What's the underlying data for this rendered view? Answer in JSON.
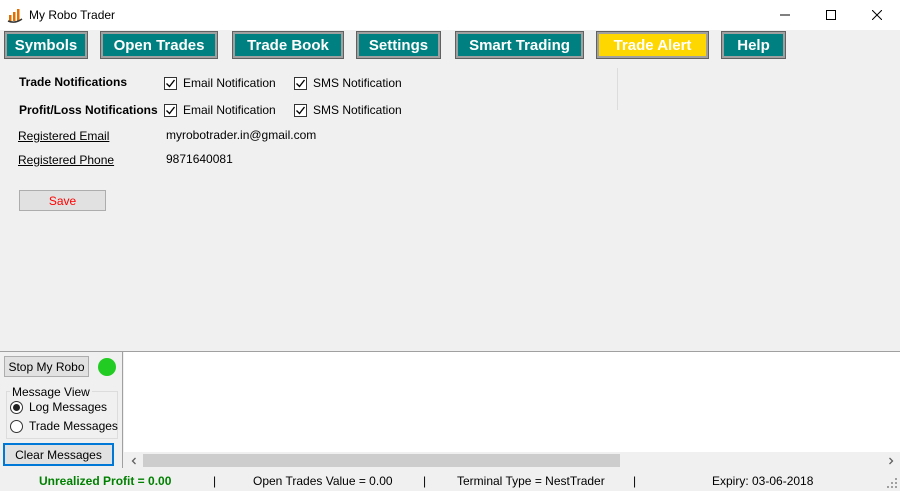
{
  "window": {
    "title": "My Robo Trader"
  },
  "nav": [
    {
      "label": "Symbols",
      "active": false
    },
    {
      "label": "Open Trades",
      "active": false
    },
    {
      "label": "Trade Book",
      "active": false
    },
    {
      "label": "Settings",
      "active": false
    },
    {
      "label": "Smart Trading",
      "active": false
    },
    {
      "label": "Trade Alert",
      "active": true
    },
    {
      "label": "Help",
      "active": false
    }
  ],
  "alert": {
    "trade_notifications_label": "Trade Notifications",
    "profit_loss_label": "Profit/Loss Notifications",
    "email_notification": "Email Notification",
    "sms_notification": "SMS Notification",
    "trade_email_checked": true,
    "trade_sms_checked": true,
    "pl_email_checked": true,
    "pl_sms_checked": true,
    "registered_email_label": "Registered Email",
    "registered_email_value": "myrobotrader.in@gmail.com",
    "registered_phone_label": "Registered Phone",
    "registered_phone_value": "9871640081",
    "save_label": "Save"
  },
  "control": {
    "stop_label": "Stop My Robo",
    "status_color": "#22cc22",
    "message_view_title": "Message View",
    "log_messages_label": "Log Messages",
    "trade_messages_label": "Trade Messages",
    "selected_view": "log",
    "clear_label": "Clear Messages"
  },
  "status": {
    "unrealized_profit": "Unrealized Profit = 0.00",
    "open_trades_value": "Open Trades Value = 0.00",
    "terminal_type": "Terminal Type = NestTrader",
    "expiry": "Expiry: 03-06-2018",
    "separator": "|"
  },
  "colors": {
    "nav_bg": "#008080",
    "nav_active": "#ffd700",
    "save_text": "#ff0000",
    "profit_text": "#008000"
  }
}
